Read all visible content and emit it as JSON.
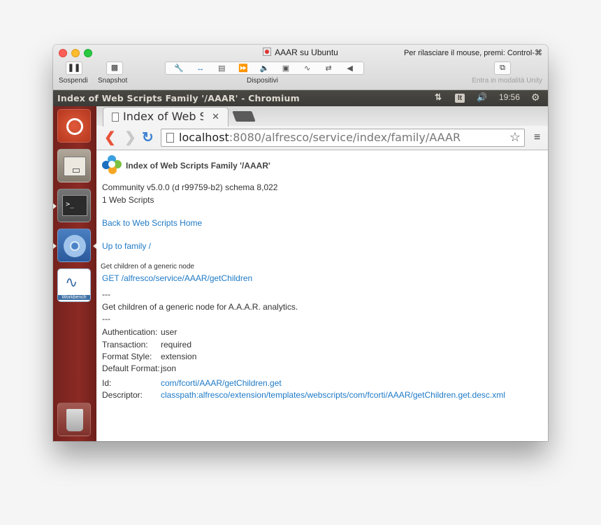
{
  "vm_window": {
    "title": "AAAR su Ubuntu",
    "release_hint": "Per rilasciare il mouse, premi: Control-⌘",
    "suspend_label": "Sospendi",
    "snapshot_label": "Snapshot",
    "devices_label": "Dispositivi",
    "unity_label": "Entra in modalità Unity"
  },
  "ubuntu_panel": {
    "window_title": "Index of Web Scripts Family '/AAAR' - Chromium",
    "keyboard_layout": "It",
    "time": "19:56"
  },
  "browser": {
    "tab_title": "Index of Web Scri",
    "url_host": "localhost",
    "url_rest": ":8080/alfresco/service/index/family/AAAR"
  },
  "page": {
    "heading": "Index of Web Scripts Family '/AAAR'",
    "version_line": "Community v5.0.0 (d r99759-b2) schema 8,022",
    "count_line": "1 Web Scripts",
    "back_link": "Back to Web Scripts Home",
    "up_link": "Up to family /",
    "script": {
      "short_name": "Get children of a generic node",
      "method_url": "GET /alfresco/service/AAAR/getChildren",
      "sep1": "---",
      "description": "Get children of a generic node for A.A.A.R. analytics.",
      "sep2": "---",
      "details": [
        {
          "label": "Authentication:",
          "value": "user"
        },
        {
          "label": "Transaction:",
          "value": "required"
        },
        {
          "label": "Format Style:",
          "value": "extension"
        },
        {
          "label": "Default Format:",
          "value": "json"
        }
      ],
      "id_label": "Id:",
      "id_value": "com/fcorti/AAAR/getChildren.get",
      "descriptor_label": "Descriptor:",
      "descriptor_value": "classpath:alfresco/extension/templates/webscripts/com/fcorti/AAAR/getChildren.get.desc.xml"
    }
  },
  "launcher": {
    "workbench_label": "Workbench"
  },
  "colors": {
    "link": "#1f7ac6",
    "launcher": "#8c2a24",
    "panel": "#3c3b37"
  }
}
